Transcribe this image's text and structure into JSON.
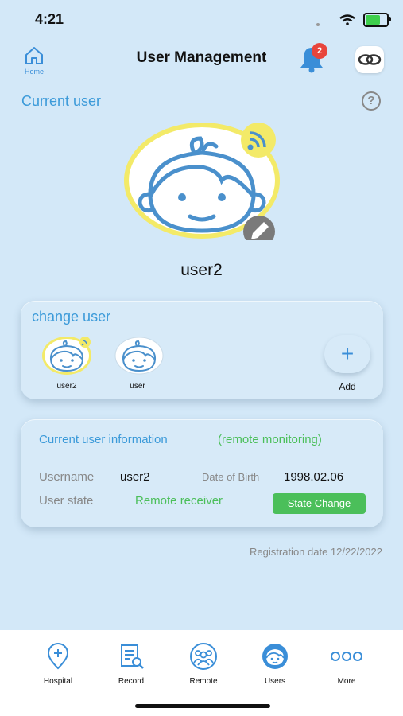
{
  "status_bar": {
    "time": "4:21"
  },
  "header": {
    "title": "User Management",
    "home_label": "Home",
    "notification_count": "2"
  },
  "current_user": {
    "heading": "Current user",
    "help": "?",
    "name": "user2"
  },
  "change_user": {
    "heading": "change user",
    "users": [
      {
        "label": "user2",
        "active": true
      },
      {
        "label": "user",
        "active": false
      }
    ],
    "add_label": "Add",
    "add_symbol": "+"
  },
  "info": {
    "heading": "Current user information",
    "mode": "(remote monitoring)",
    "username_label": "Username",
    "username_value": "user2",
    "dob_label": "Date of Birth",
    "dob_value": "1998.02.06",
    "state_label": "User state",
    "state_value": "Remote receiver",
    "state_button": "State Change"
  },
  "registration": "Registration date 12/22/2022",
  "tabs": [
    {
      "label": "Hospital",
      "icon": "hospital-pin-icon"
    },
    {
      "label": "Record",
      "icon": "record-clipboard-icon"
    },
    {
      "label": "Remote",
      "icon": "remote-group-icon"
    },
    {
      "label": "Users",
      "icon": "users-face-icon"
    },
    {
      "label": "More",
      "icon": "more-dots-icon"
    }
  ],
  "colors": {
    "accent": "#3b9ad9",
    "green": "#4bbf5a",
    "background": "#d3e8f8",
    "highlight": "#f3ea68",
    "badge": "#e8453c"
  }
}
